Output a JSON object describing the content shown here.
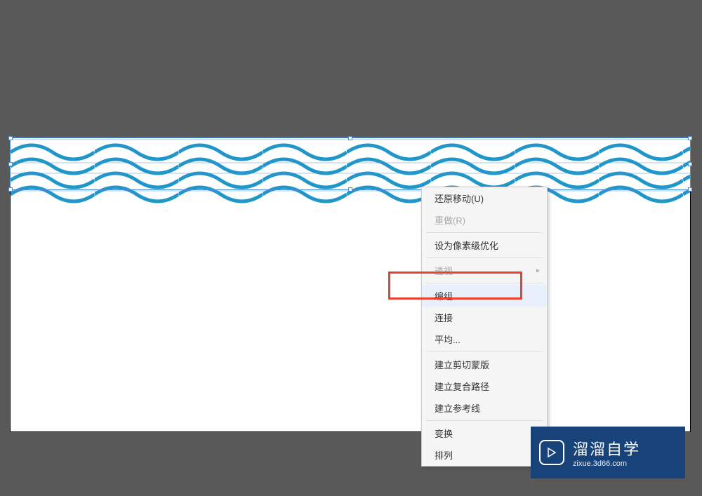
{
  "contextMenu": {
    "undo_move": "还原移动(U)",
    "redo": "重做(R)",
    "pixel_perfect": "设为像素级优化",
    "perspective": "透视",
    "group": "编组",
    "join": "连接",
    "average": "平均...",
    "make_clipping_mask": "建立剪切蒙版",
    "make_compound_path": "建立复合路径",
    "make_guides": "建立参考线",
    "transform": "变换",
    "arrange": "排列"
  },
  "watermark": {
    "title": "溜溜自学",
    "url": "zixue.3d66.com"
  },
  "colors": {
    "wave_color": "#2196c9",
    "selection_color": "#4a90d9",
    "highlight_color": "#e84030",
    "watermark_bg": "#17437a"
  }
}
